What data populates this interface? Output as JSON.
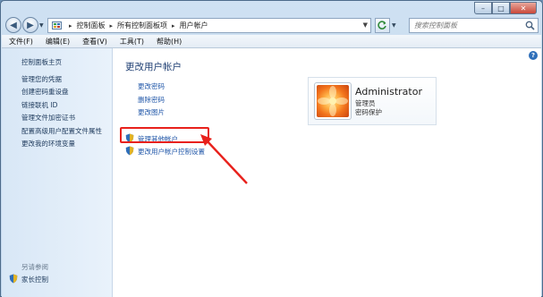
{
  "window": {
    "caption_buttons": {
      "minimize": "–",
      "maximize": "□",
      "close": "✕"
    }
  },
  "nav": {
    "breadcrumb": [
      "控制面板",
      "所有控制面板项",
      "用户帐户"
    ],
    "search_placeholder": "搜索控制面板"
  },
  "menu": [
    "文件(F)",
    "编辑(E)",
    "查看(V)",
    "工具(T)",
    "帮助(H)"
  ],
  "sidebar": {
    "items": [
      "控制面板主页",
      "管理您的凭据",
      "创建密码重设盘",
      "链接联机 ID",
      "管理文件加密证书",
      "配置高级用户配置文件属性",
      "更改我的环境变量"
    ],
    "see_also_label": "另请参阅",
    "family_link": "家长控制"
  },
  "main": {
    "title": "更改用户帐户",
    "tasks": [
      "更改密码",
      "删除密码",
      "更改图片"
    ],
    "shield_tasks": [
      "管理其他帐户",
      "更改用户帐户控制设置"
    ],
    "help": "?"
  },
  "user": {
    "name": "Administrator",
    "role": "管理员",
    "password_status": "密码保护"
  },
  "colors": {
    "highlight": "#e8211c",
    "link": "#1f56a8",
    "title": "#1f3f73"
  }
}
